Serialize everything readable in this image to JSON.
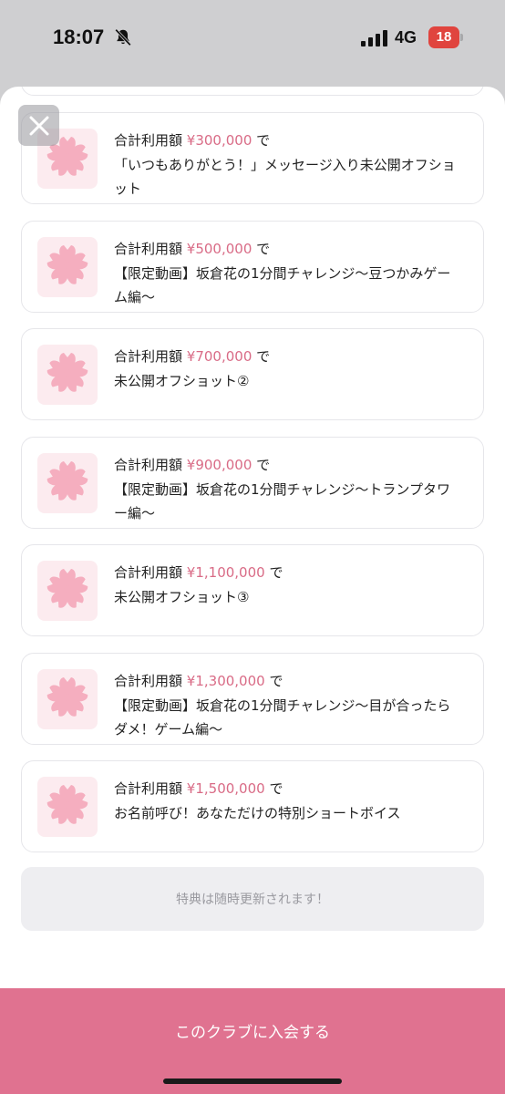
{
  "status_bar": {
    "time": "18:07",
    "network": "4G",
    "battery": "18",
    "icons": [
      "bell-slash-icon",
      "signal-icon",
      "battery-icon"
    ]
  },
  "close": {
    "icon": "close-icon"
  },
  "rewards": [
    {
      "prefix": "合計利用額",
      "amount": "¥300,000",
      "suffix": "で",
      "description": "「いつもありがとう！」メッセージ入り未公開オフショット"
    },
    {
      "prefix": "合計利用額",
      "amount": "¥500,000",
      "suffix": "で",
      "description": "【限定動画】坂倉花の1分間チャレンジ〜豆つかみゲーム編〜"
    },
    {
      "prefix": "合計利用額",
      "amount": "¥700,000",
      "suffix": "で",
      "description": "未公開オフショット②"
    },
    {
      "prefix": "合計利用額",
      "amount": "¥900,000",
      "suffix": "で",
      "description": "【限定動画】坂倉花の1分間チャレンジ〜トランプタワー編〜"
    },
    {
      "prefix": "合計利用額",
      "amount": "¥1,100,000",
      "suffix": "で",
      "description": "未公開オフショット③"
    },
    {
      "prefix": "合計利用額",
      "amount": "¥1,300,000",
      "suffix": "で",
      "description": "【限定動画】坂倉花の1分間チャレンジ〜目が合ったらダメ！ゲーム編〜"
    },
    {
      "prefix": "合計利用額",
      "amount": "¥1,500,000",
      "suffix": "で",
      "description": "お名前呼び！あなただけの特別ショートボイス"
    }
  ],
  "reward_icon": "sakura-icon",
  "notice": "特典は随時更新されます！",
  "join_button": "このクラブに入会する",
  "colors": {
    "accent": "#e07290",
    "amount": "#d96b86",
    "thumb_bg": "#fcebef",
    "flower": "#f5aebf"
  }
}
